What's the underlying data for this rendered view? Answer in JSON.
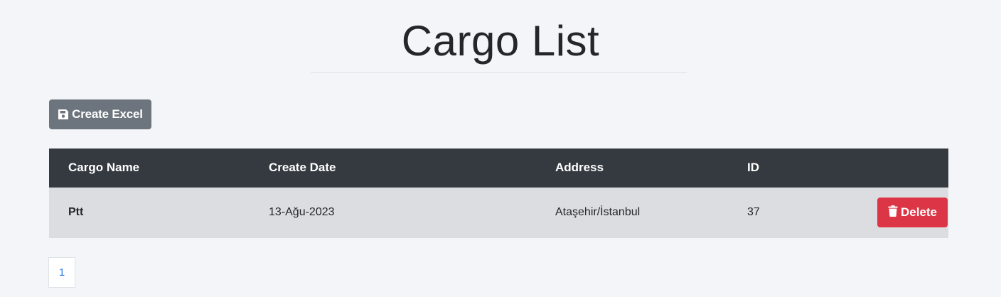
{
  "header": {
    "title": "Cargo List"
  },
  "toolbar": {
    "create_excel_label": "Create Excel",
    "create_excel_icon": "save-icon",
    "create_excel_color": "#6c757d"
  },
  "table": {
    "columns": [
      "Cargo Name",
      "Create Date",
      "Address",
      "ID"
    ],
    "rows": [
      {
        "cargo_name": "Ptt",
        "create_date": "13-Ağu-2023",
        "address": "Ataşehir/İstanbul",
        "id": "37",
        "delete_label": "Delete"
      }
    ],
    "header_color": "#343a40",
    "row_color": "#dcdde0"
  },
  "actions": {
    "delete_icon": "trash-icon",
    "delete_color": "#dc3545"
  },
  "pagination": {
    "pages": [
      "1"
    ],
    "current": "1"
  }
}
